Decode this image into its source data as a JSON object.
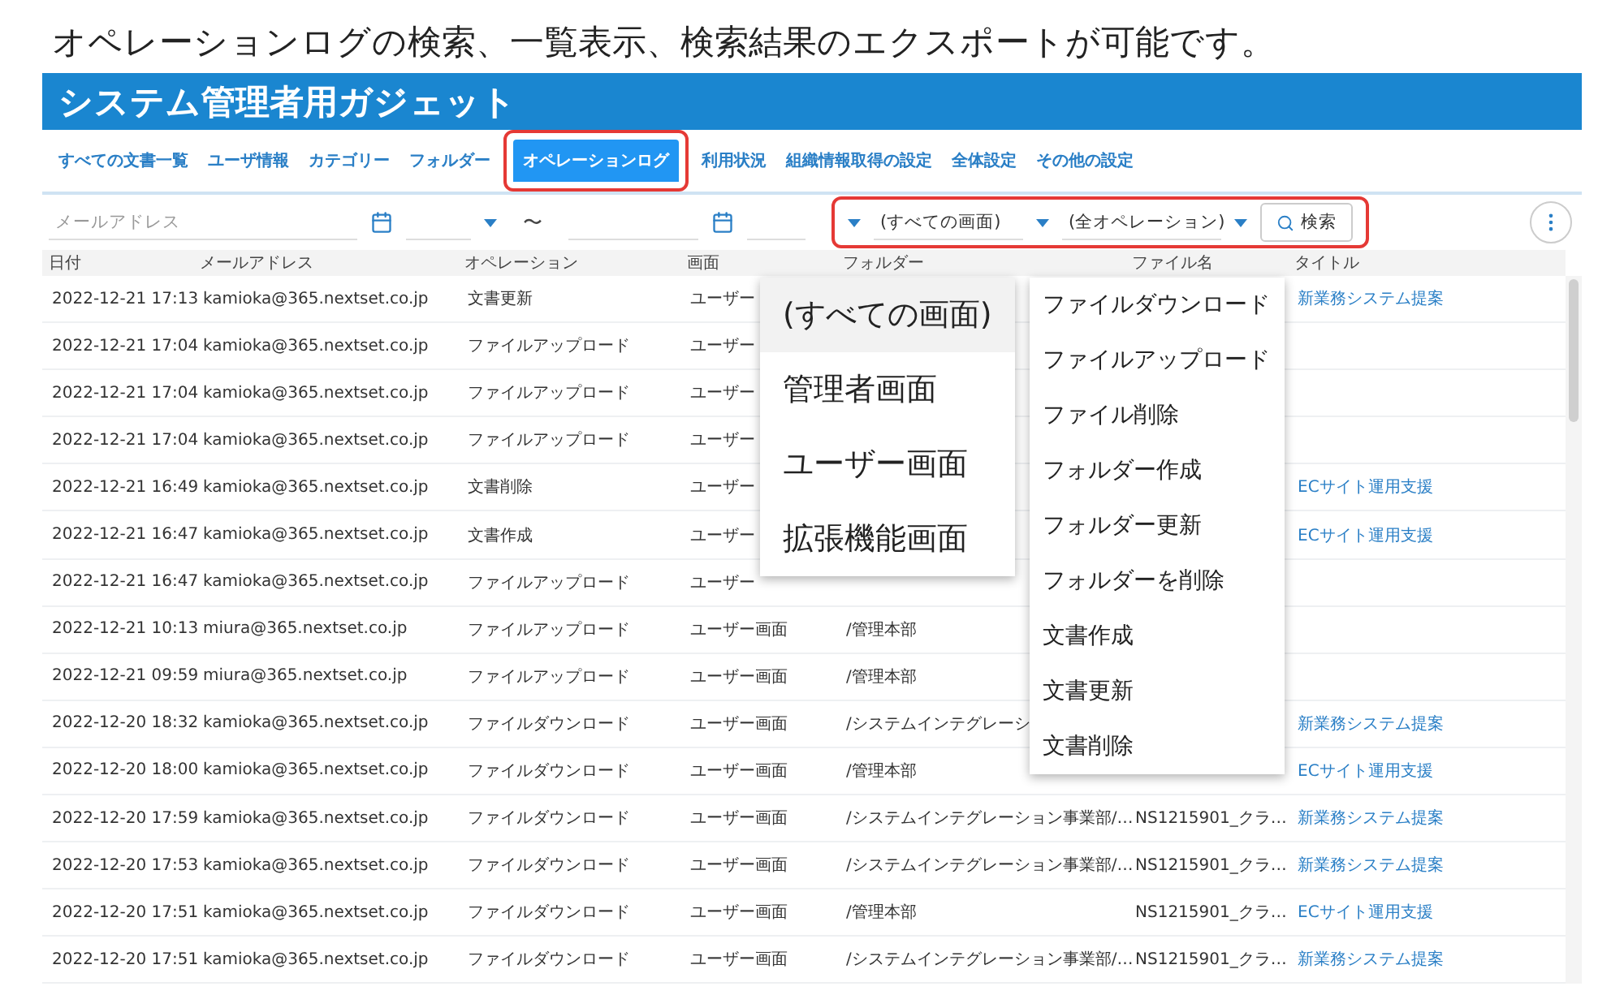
{
  "caption": "オペレーションログの検索、一覧表示、検索結果のエクスポートが可能です。",
  "header": {
    "title": "システム管理者用ガジェット"
  },
  "tabs": [
    {
      "label": "すべての文書一覧",
      "selected": false
    },
    {
      "label": "ユーザ情報",
      "selected": false
    },
    {
      "label": "カテゴリー",
      "selected": false
    },
    {
      "label": "フォルダー",
      "selected": false
    },
    {
      "label": "オペレーションログ",
      "selected": true
    },
    {
      "label": "利用状況",
      "selected": false
    },
    {
      "label": "組織情報取得の設定",
      "selected": false
    },
    {
      "label": "全体設定",
      "selected": false
    },
    {
      "label": "その他の設定",
      "selected": false
    }
  ],
  "filters": {
    "email": {
      "placeholder": "メールアドレス"
    },
    "range_separator": "〜",
    "screen_select": {
      "value": "(すべての画面)"
    },
    "operation_select": {
      "value": "(全オペレーション)"
    },
    "search_button": {
      "label": "検索"
    }
  },
  "table": {
    "columns": [
      "日付",
      "メールアドレス",
      "オペレーション",
      "画面",
      "フォルダー",
      "ファイル名",
      "タイトル"
    ],
    "rows": [
      {
        "date": "2022-12-21 17:13",
        "email": "kamioka@365.nextset.co.jp",
        "operation": "文書更新",
        "screen": "ユーザー",
        "title": "新業務システム提案"
      },
      {
        "date": "2022-12-21 17:04",
        "email": "kamioka@365.nextset.co.jp",
        "operation": "ファイルアップロード",
        "screen": "ユーザー"
      },
      {
        "date": "2022-12-21 17:04",
        "email": "kamioka@365.nextset.co.jp",
        "operation": "ファイルアップロード",
        "screen": "ユーザー"
      },
      {
        "date": "2022-12-21 17:04",
        "email": "kamioka@365.nextset.co.jp",
        "operation": "ファイルアップロード",
        "screen": "ユーザー"
      },
      {
        "date": "2022-12-21 16:49",
        "email": "kamioka@365.nextset.co.jp",
        "operation": "文書削除",
        "screen": "ユーザー",
        "title": "ECサイト運用支援"
      },
      {
        "date": "2022-12-21 16:47",
        "email": "kamioka@365.nextset.co.jp",
        "operation": "文書作成",
        "screen": "ユーザー",
        "title": "ECサイト運用支援"
      },
      {
        "date": "2022-12-21 16:47",
        "email": "kamioka@365.nextset.co.jp",
        "operation": "ファイルアップロード",
        "screen": "ユーザー"
      },
      {
        "date": "2022-12-21 10:13",
        "email": "miura@365.nextset.co.jp",
        "operation": "ファイルアップロード",
        "screen": "ユーザー画面",
        "folder": "/管理本部"
      },
      {
        "date": "2022-12-21 09:59",
        "email": "miura@365.nextset.co.jp",
        "operation": "ファイルアップロード",
        "screen": "ユーザー画面",
        "folder": "/管理本部"
      },
      {
        "date": "2022-12-20 18:32",
        "email": "kamioka@365.nextset.co.jp",
        "operation": "ファイルダウンロード",
        "screen": "ユーザー画面",
        "folder": "/システムインテグレーシ",
        "title": "新業務システム提案"
      },
      {
        "date": "2022-12-20 18:00",
        "email": "kamioka@365.nextset.co.jp",
        "operation": "ファイルダウンロード",
        "screen": "ユーザー画面",
        "folder": "/管理本部",
        "title": "ECサイト運用支援"
      },
      {
        "date": "2022-12-20 17:59",
        "email": "kamioka@365.nextset.co.jp",
        "operation": "ファイルダウンロード",
        "screen": "ユーザー画面",
        "folder": "/システムインテグレーション事業部/…",
        "file": "NS1215901_クラ…",
        "title": "新業務システム提案"
      },
      {
        "date": "2022-12-20 17:53",
        "email": "kamioka@365.nextset.co.jp",
        "operation": "ファイルダウンロード",
        "screen": "ユーザー画面",
        "folder": "/システムインテグレーション事業部/…",
        "file": "NS1215901_クラ…",
        "title": "新業務システム提案"
      },
      {
        "date": "2022-12-20 17:51",
        "email": "kamioka@365.nextset.co.jp",
        "operation": "ファイルダウンロード",
        "screen": "ユーザー画面",
        "folder": "/管理本部",
        "file": "NS1215901_クラ…",
        "title": "ECサイト運用支援"
      },
      {
        "date": "2022-12-20 17:51",
        "email": "kamioka@365.nextset.co.jp",
        "operation": "ファイルダウンロード",
        "screen": "ユーザー画面",
        "folder": "/システムインテグレーション事業部/…",
        "file": "NS1215901_クラ…",
        "title": "新業務システム提案"
      }
    ]
  },
  "screen_menu": {
    "items": [
      {
        "label": "(すべての画面)",
        "selected": true
      },
      {
        "label": "管理者画面",
        "selected": false
      },
      {
        "label": "ユーザー画面",
        "selected": false
      },
      {
        "label": "拡張機能画面",
        "selected": false
      }
    ]
  },
  "operation_menu": {
    "items": [
      "ファイルダウンロード",
      "ファイルアップロード",
      "ファイル削除",
      "フォルダー作成",
      "フォルダー更新",
      "フォルダーを削除",
      "文書作成",
      "文書更新",
      "文書削除"
    ]
  }
}
